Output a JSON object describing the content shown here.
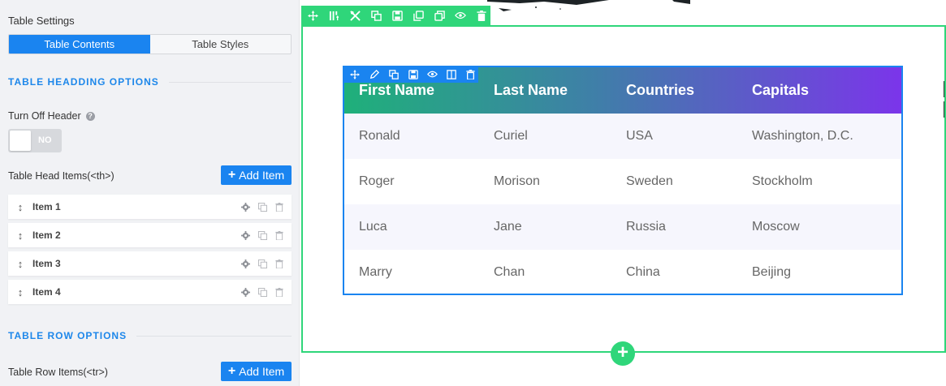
{
  "panel": {
    "title": "Table Settings",
    "tabs": [
      {
        "label": "Table Contents",
        "active": true
      },
      {
        "label": "Table Styles",
        "active": false
      }
    ],
    "heading_section": "TABLE HEADDING OPTIONS",
    "turn_off_header": {
      "label": "Turn Off Header",
      "help_icon": "question-icon",
      "toggle_value": "NO"
    },
    "head_items_label": "Table Head Items(<th>)",
    "add_item_label": "Add Item",
    "head_items": [
      {
        "label": "Item 1"
      },
      {
        "label": "Item 2"
      },
      {
        "label": "Item 3"
      },
      {
        "label": "Item 4"
      }
    ],
    "row_section": "TABLE ROW OPTIONS",
    "row_items_label": "Table Row Items(<tr>)",
    "add_row_label": "Add Item"
  },
  "table": {
    "headers": [
      "First Name",
      "Last Name",
      "Countries",
      "Capitals"
    ],
    "rows": [
      [
        "Ronald",
        "Curiel",
        "USA",
        "Washington, D.C."
      ],
      [
        "Roger",
        "Morison",
        "Sweden",
        "Stockholm"
      ],
      [
        "Luca",
        "Jane",
        "Russia",
        "Moscow"
      ],
      [
        "Marry",
        "Chan",
        "China",
        "Beijing"
      ]
    ]
  },
  "colors": {
    "accent": "#1a84f0",
    "section_green": "#2fd67a",
    "header_gradient_start": "#1fb07a",
    "header_gradient_end": "#7b35ea"
  },
  "icons": {
    "section_toolbar": [
      "move-icon",
      "columns-icon",
      "tools-icon",
      "copy-icon",
      "save-icon",
      "duplicate-icon",
      "paste-icon",
      "eye-icon",
      "trash-icon"
    ],
    "table_toolbar": [
      "move-icon",
      "pencil-icon",
      "copy-icon",
      "save-icon",
      "eye-icon",
      "columns-icon",
      "trash-icon"
    ],
    "item_actions": [
      "gear-icon",
      "copy-icon",
      "trash-icon"
    ],
    "add_section": "plus-icon"
  }
}
